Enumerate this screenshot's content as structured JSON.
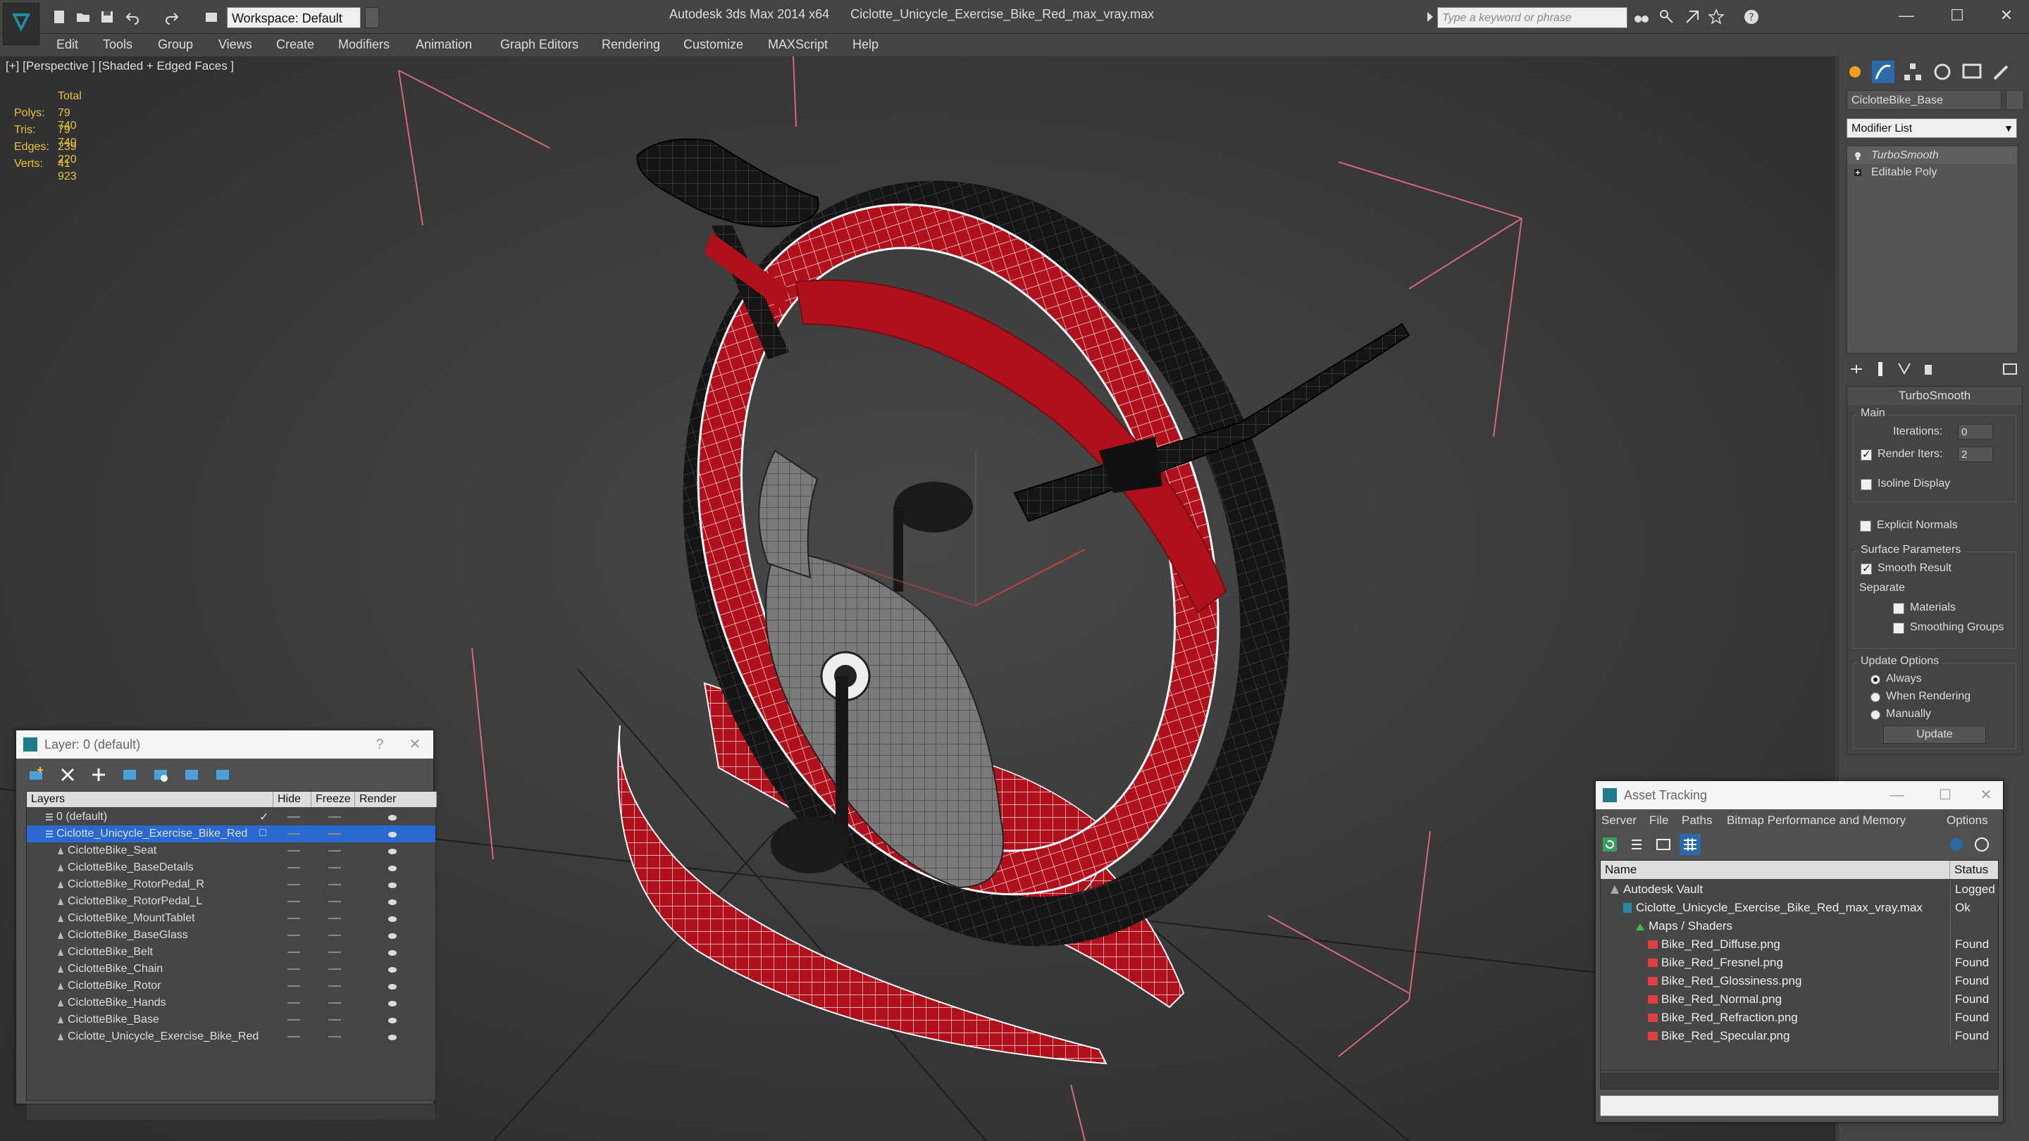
{
  "titlebar": {
    "workspace": "Workspace: Default",
    "app_name": "Autodesk 3ds Max 2014 x64",
    "file_name": "Ciclotte_Unicycle_Exercise_Bike_Red_max_vray.max",
    "search_placeholder": "Type a keyword or phrase"
  },
  "menu": [
    "Edit",
    "Tools",
    "Group",
    "Views",
    "Create",
    "Modifiers",
    "Animation",
    "Graph Editors",
    "Rendering",
    "Customize",
    "MAXScript",
    "Help"
  ],
  "viewport": {
    "label": "[+] [Perspective ] [Shaded + Edged Faces ]",
    "stats": {
      "total_label": "Total",
      "rows": [
        {
          "k": "Polys:",
          "v": "79 740"
        },
        {
          "k": "Tris:",
          "v": "79 740"
        },
        {
          "k": "Edges:",
          "v": "239 220"
        },
        {
          "k": "Verts:",
          "v": "41 923"
        }
      ]
    }
  },
  "command_panel": {
    "object_name": "CiclotteBike_Base",
    "modifier_list": "Modifier List",
    "stack": [
      "TurboSmooth",
      "Editable Poly"
    ],
    "rollout_title": "TurboSmooth",
    "main_label": "Main",
    "iterations_label": "Iterations:",
    "iterations_value": "0",
    "render_iters_label": "Render Iters:",
    "render_iters_value": "2",
    "isoline_label": "Isoline Display",
    "explicit_normals_label": "Explicit Normals",
    "surface_params_label": "Surface Parameters",
    "smooth_result_label": "Smooth Result",
    "separate_label": "Separate",
    "materials_label": "Materials",
    "smoothing_groups_label": "Smoothing Groups",
    "update_options_label": "Update Options",
    "always_label": "Always",
    "when_rendering_label": "When Rendering",
    "manually_label": "Manually",
    "update_button": "Update"
  },
  "layer_window": {
    "title": "Layer: 0 (default)",
    "help": "?",
    "headers": {
      "layers": "Layers",
      "hide": "Hide",
      "freeze": "Freeze",
      "render": "Render"
    },
    "rows": [
      {
        "name": "0 (default)",
        "level": 0
      },
      {
        "name": "Ciclotte_Unicycle_Exercise_Bike_Red",
        "level": 0
      },
      {
        "name": "CiclotteBike_Seat",
        "level": 1
      },
      {
        "name": "CiclotteBike_BaseDetails",
        "level": 1
      },
      {
        "name": "CiclotteBike_RotorPedal_R",
        "level": 1
      },
      {
        "name": "CiclotteBike_RotorPedal_L",
        "level": 1
      },
      {
        "name": "CiclotteBike_MountTablet",
        "level": 1
      },
      {
        "name": "CiclotteBike_BaseGlass",
        "level": 1
      },
      {
        "name": "CiclotteBike_Belt",
        "level": 1
      },
      {
        "name": "CiclotteBike_Chain",
        "level": 1
      },
      {
        "name": "CiclotteBike_Rotor",
        "level": 1
      },
      {
        "name": "CiclotteBike_Hands",
        "level": 1
      },
      {
        "name": "CiclotteBike_Base",
        "level": 1
      },
      {
        "name": "Ciclotte_Unicycle_Exercise_Bike_Red",
        "level": 1
      }
    ]
  },
  "asset_window": {
    "title": "Asset Tracking",
    "menu": [
      "Server",
      "File",
      "Paths",
      "Bitmap Performance and Memory",
      "Options"
    ],
    "headers": {
      "name": "Name",
      "status": "Status"
    },
    "rows": [
      {
        "name": "Autodesk Vault",
        "status": "Logged Out",
        "level": 0
      },
      {
        "name": "Ciclotte_Unicycle_Exercise_Bike_Red_max_vray.max",
        "status": "Ok",
        "level": 1
      },
      {
        "name": "Maps / Shaders",
        "status": "",
        "level": 2
      },
      {
        "name": "Bike_Red_Diffuse.png",
        "status": "Found",
        "level": 3
      },
      {
        "name": "Bike_Red_Fresnel.png",
        "status": "Found",
        "level": 3
      },
      {
        "name": "Bike_Red_Glossiness.png",
        "status": "Found",
        "level": 3
      },
      {
        "name": "Bike_Red_Normal.png",
        "status": "Found",
        "level": 3
      },
      {
        "name": "Bike_Red_Refraction.png",
        "status": "Found",
        "level": 3
      },
      {
        "name": "Bike_Red_Specular.png",
        "status": "Found",
        "level": 3
      }
    ]
  }
}
